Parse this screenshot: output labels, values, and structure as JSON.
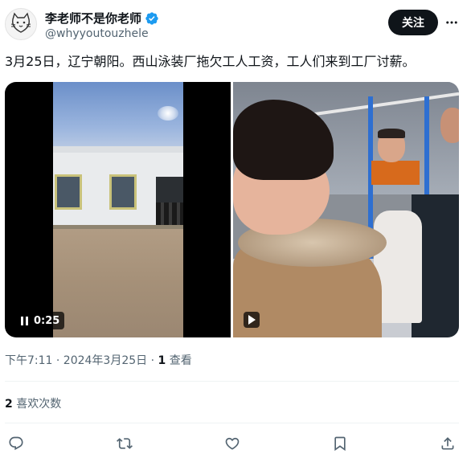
{
  "author": {
    "display_name": "李老师不是你老师",
    "handle": "@whyyoutouzhele",
    "verified": true
  },
  "header": {
    "follow_label": "关注"
  },
  "tweet": {
    "text": "3月25日，辽宁朝阳。西山泳装厂拖欠工人工资，工人们来到工厂讨薪。"
  },
  "media": {
    "video_left": {
      "duration": "0:25",
      "state": "paused"
    },
    "video_right": {
      "state": "play"
    }
  },
  "meta": {
    "timestamp": "下午7:11 · 2024年3月25日 · ",
    "views_count": "1",
    "views_label": " 查看"
  },
  "stats": {
    "likes_count": "2",
    "likes_label": " 喜欢次数"
  },
  "actions": [
    {
      "name": "reply",
      "icon": "reply-icon"
    },
    {
      "name": "repost",
      "icon": "repost-icon"
    },
    {
      "name": "like",
      "icon": "heart-icon"
    },
    {
      "name": "bookmark",
      "icon": "bookmark-icon"
    },
    {
      "name": "share",
      "icon": "share-icon"
    }
  ],
  "colors": {
    "verified_blue": "#1d9bf0",
    "text_primary": "#0f1419",
    "text_secondary": "#536471"
  }
}
